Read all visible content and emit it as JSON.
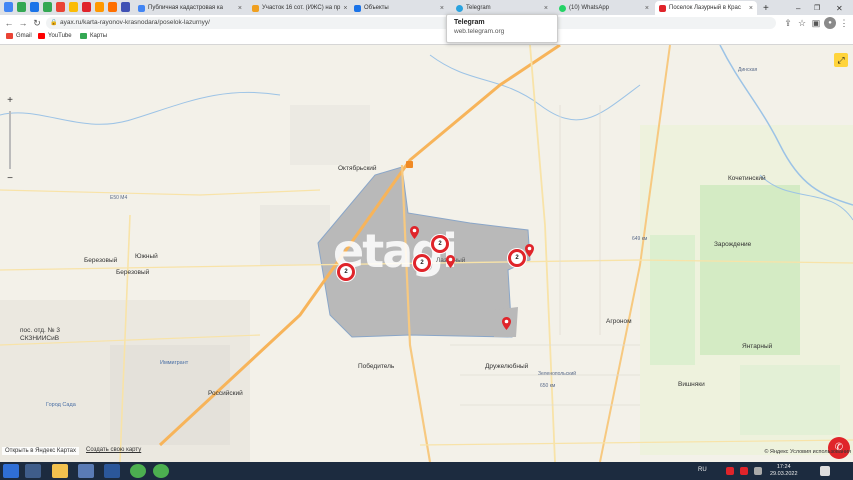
{
  "browser": {
    "tabs": [
      {
        "title": "Публичная кадастровая ка",
        "icon": "globe-icon",
        "color": "#4285f4"
      },
      {
        "title": "Участок 16 сот. (ИЖС) на пр",
        "icon": "globe-icon",
        "color": "#f0a020"
      },
      {
        "title": "Объекты",
        "icon": "globe-icon",
        "color": "#1a73e8"
      },
      {
        "title": "Telegram",
        "icon": "telegram-icon",
        "color": "#2aa3df"
      },
      {
        "title": "(10) WhatsApp",
        "icon": "whatsapp-icon",
        "color": "#25d366"
      },
      {
        "title": "Поселок Лазурный в Крас",
        "icon": "etagi-icon",
        "color": "#e0242a"
      }
    ],
    "active_tab": 5,
    "new_tab_label": "+",
    "url": "ayax.ru/karta-rayonov-krasnodara/poselok-lazurnyy/",
    "bookmarks": [
      {
        "label": "Gmail",
        "color": "#ea4335"
      },
      {
        "label": "YouTube",
        "color": "#ff0000"
      },
      {
        "label": "Карты",
        "color": "#34a853"
      }
    ],
    "tooltip": {
      "title": "Telegram",
      "url": "web.telegram.org"
    }
  },
  "map": {
    "watermark": "etagi",
    "zoom_in": "+",
    "zoom_out": "−",
    "labels": {
      "oktyabrsky": "Октябрьский",
      "berezovy": "Березовый",
      "yuzhny": "Южный",
      "berezovy2": "Березовый",
      "lazurny": "Лазурный",
      "pos_otd3": "пос. отд. № 3",
      "sknisp": "СКЗНИИСиВ",
      "pobeditel": "Победитель",
      "druzhelyubny": "Дружелюбный",
      "zelenopolsky": "Зеленопольский",
      "agronom": "Агроном",
      "vintarny": "Янтарный",
      "vishnyaki": "Вишняки",
      "kochetinsky": "Кочетинский",
      "zarozhdenie": "Зарождение",
      "dinskaya": "Динская",
      "rossiysky": "Российский",
      "gorod_sada": "Город Сада",
      "immigrant": "Иммигрант",
      "km650": "650 км",
      "km649": "649 км",
      "e50": "Е50 М4"
    },
    "clusters": [
      {
        "count": "2"
      },
      {
        "count": "2"
      },
      {
        "count": "2"
      },
      {
        "count": "2"
      }
    ],
    "footer": {
      "open_in": "Открыть в Яндекс Картах",
      "report_error": "Создать свою карту",
      "copyright": "© Яндекс Условия использования"
    },
    "accent_color": "#e0242a",
    "zone_color": "#b9b9b9"
  },
  "taskbar": {
    "language": "RU",
    "time": "17:24",
    "date": "29.03.2022"
  }
}
